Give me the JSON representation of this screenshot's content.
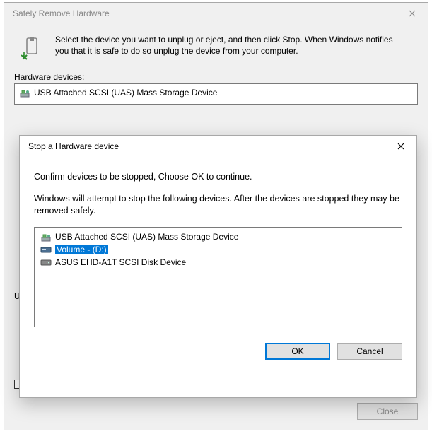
{
  "parent": {
    "title": "Safely Remove Hardware",
    "intro": "Select the device you want to unplug or eject, and then click Stop. When Windows notifies you that it is safe to do so unplug the device from your computer.",
    "list_label": "Hardware devices:",
    "devices": [
      {
        "label": "USB Attached SCSI (UAS) Mass Storage Device",
        "icon": "usb-device"
      }
    ],
    "truncated_label": "US",
    "close_label": "Close"
  },
  "modal": {
    "title": "Stop a Hardware device",
    "para1": "Confirm devices to be stopped, Choose OK to continue.",
    "para2": "Windows will attempt to stop the following devices. After the devices are stopped they may be removed safely.",
    "devices": [
      {
        "label": "USB Attached SCSI (UAS) Mass Storage Device",
        "icon": "usb-device",
        "indent": 0,
        "selected": false
      },
      {
        "label": "Volume - (D:)",
        "icon": "drive",
        "indent": 0,
        "selected": true
      },
      {
        "label": "ASUS EHD-A1T SCSI Disk Device",
        "icon": "disk",
        "indent": 0,
        "selected": false
      }
    ],
    "ok_label": "OK",
    "cancel_label": "Cancel"
  }
}
